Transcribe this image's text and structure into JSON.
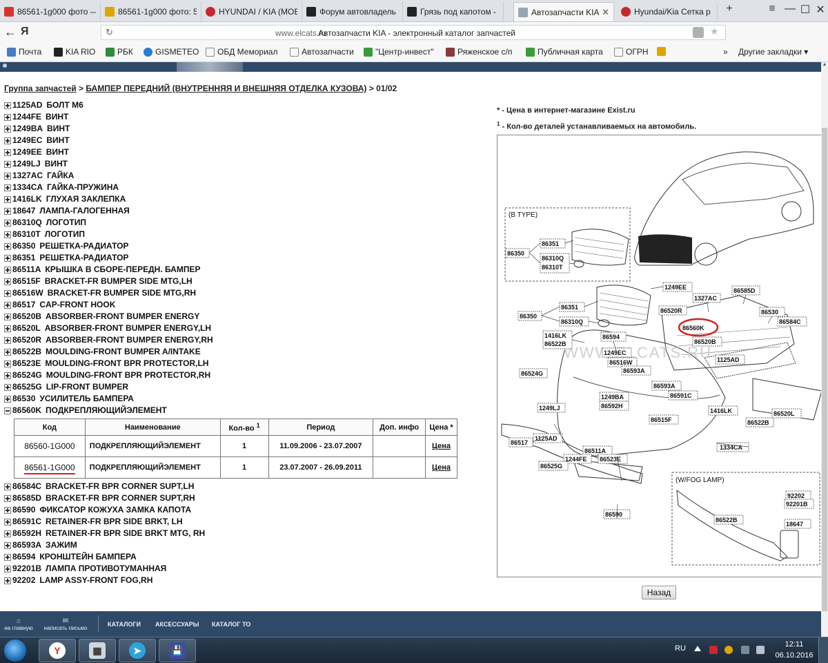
{
  "browser": {
    "tabs": [
      {
        "title": "86561-1g000 фото —",
        "color": "#d9342b"
      },
      {
        "title": "86561-1g000 фото: 5",
        "color": "#e0a400"
      },
      {
        "title": "HYUNDAI / KIA (MOB",
        "color": "#c8282d"
      },
      {
        "title": "Форум автовладель",
        "color": "#222222"
      },
      {
        "title": "Грязь под капотом -",
        "color": "#222222"
      },
      {
        "title": "Автозапчасти KIA",
        "color": "#9aa5b1"
      },
      {
        "title": "Hyundai/Kia Сетка р",
        "color": "#c8282d"
      }
    ],
    "new_tab": "+",
    "window_controls": {
      "menu": "≡",
      "minimize": "—",
      "maximize": "☐",
      "close": "✕"
    },
    "back": "←",
    "yandex_logo": "Я",
    "reload": "↻",
    "url_domain": "www.elcats.ru",
    "url_title": "Автозапчасти KIA - электронный каталог запчастей",
    "bookmarks": [
      {
        "label": "Почта",
        "color": "#4a7bc4"
      },
      {
        "label": "KIA RIO",
        "color": "#222222"
      },
      {
        "label": "РБК",
        "color": "#2d8a3e"
      },
      {
        "label": "GISMETEO",
        "color": "#2b7bd6"
      },
      {
        "label": "ОБД Мемориал",
        "color": "#888888"
      },
      {
        "label": "Автозапчасти",
        "color": "#888888"
      },
      {
        "label": "\"Центр-инвест\"",
        "color": "#3c9a3c"
      },
      {
        "label": "Ряженское с/п",
        "color": "#8a3a3a"
      },
      {
        "label": "Публичная карта",
        "color": "#3c9a3c"
      },
      {
        "label": "ОГРН",
        "color": "#888888"
      },
      {
        "label": "",
        "color": "#e0a400"
      }
    ],
    "more_bookmarks": "»",
    "other_bookmarks": "Другие закладки ▾"
  },
  "page": {
    "breadcrumb": {
      "root": "Группа запчастей",
      "sep": ">",
      "group": "БАМПЕР ПЕРЕДНИЙ (ВНУТРЕННЯЯ И ВНЕШНЯЯ ОТДЕЛКА КУЗОВА)",
      "page": "01/02"
    },
    "parts_before": [
      {
        "code": "1125AD",
        "name": "БОЛТ М6"
      },
      {
        "code": "1244FE",
        "name": "ВИНТ"
      },
      {
        "code": "1249BA",
        "name": "ВИНТ"
      },
      {
        "code": "1249EC",
        "name": "ВИНТ"
      },
      {
        "code": "1249EE",
        "name": "ВИНТ"
      },
      {
        "code": "1249LJ",
        "name": "ВИНТ"
      },
      {
        "code": "1327AC",
        "name": "ГАЙКА"
      },
      {
        "code": "1334CA",
        "name": "ГАЙКА-ПРУЖИНА"
      },
      {
        "code": "1416LK",
        "name": "ГЛУХАЯ ЗАКЛЕПКА"
      },
      {
        "code": "18647",
        "name": "ЛАМПА-ГАЛОГЕННАЯ"
      },
      {
        "code": "86310Q",
        "name": "ЛОГОТИП"
      },
      {
        "code": "86310T",
        "name": "ЛОГОТИП"
      },
      {
        "code": "86350",
        "name": "РЕШЕТКА-РАДИАТОР"
      },
      {
        "code": "86351",
        "name": "РЕШЕТКА-РАДИАТОР"
      },
      {
        "code": "86511A",
        "name": "КРЫШКА В СБОРЕ-ПЕРЕДН. БАМПЕР"
      },
      {
        "code": "86515F",
        "name": "BRACKET-FR BUMPER SIDE MTG,LH"
      },
      {
        "code": "86516W",
        "name": "BRACKET-FR BUMPER SIDE MTG,RH"
      },
      {
        "code": "86517",
        "name": "CAP-FRONT HOOK"
      },
      {
        "code": "86520B",
        "name": "ABSORBER-FRONT BUMPER ENERGY"
      },
      {
        "code": "86520L",
        "name": "ABSORBER-FRONT BUMPER ENERGY,LH"
      },
      {
        "code": "86520R",
        "name": "ABSORBER-FRONT BUMPER ENERGY,RH"
      },
      {
        "code": "86522B",
        "name": "MOULDING-FRONT BUMPER A/INTAKE"
      },
      {
        "code": "86523E",
        "name": "MOULDING-FRONT BPR PROTECTOR,LH"
      },
      {
        "code": "86524G",
        "name": "MOULDING-FRONT BPR PROTECTOR,RH"
      },
      {
        "code": "86525G",
        "name": "LIP-FRONT BUMPER"
      },
      {
        "code": "86530",
        "name": "УСИЛИТЕЛЬ БАМПЕРА"
      }
    ],
    "expanded_part": {
      "code": "86560K",
      "name": "ПОДКРЕПЛЯЮЩИЙЭЛЕМЕНТ"
    },
    "table": {
      "headers": [
        "Код",
        "Наименование",
        "Кол-во",
        "Период",
        "Доп. инфо",
        "Цена *"
      ],
      "qty_sup": "1",
      "rows": [
        {
          "code": "86560-1G000",
          "name": "ПОДКРЕПЛЯЮЩИЙЭЛЕМЕНТ",
          "qty": "1",
          "period": "11.09.2006 - 23.07.2007",
          "info": "",
          "price": "Цена"
        },
        {
          "code": "86561-1G000",
          "name": "ПОДКРЕПЛЯЮЩИЙЭЛЕМЕНТ",
          "qty": "1",
          "period": "23.07.2007 - 26.09.2011",
          "info": "",
          "price": "Цена"
        }
      ]
    },
    "parts_after": [
      {
        "code": "86584C",
        "name": "BRACKET-FR BPR CORNER SUPT,LH"
      },
      {
        "code": "86585D",
        "name": "BRACKET-FR BPR CORNER SUPT,RH"
      },
      {
        "code": "86590",
        "name": "ФИКСАТОР КОЖУХА ЗАМКА КАПОТА"
      },
      {
        "code": "86591C",
        "name": "RETAINER-FR BPR SIDE BRKT, LH"
      },
      {
        "code": "86592H",
        "name": "RETAINER-FR BPR SIDE BRKT MTG, RH"
      },
      {
        "code": "86593A",
        "name": "ЗАЖИМ"
      },
      {
        "code": "86594",
        "name": "КРОНШТЕЙН БАМПЕРА"
      },
      {
        "code": "92201B",
        "name": "ЛАМПА ПРОТИВОТУМАННАЯ"
      },
      {
        "code": "92202",
        "name": "LAMP ASSY-FRONT FOG,RH"
      }
    ],
    "notes": {
      "price_mark": "*",
      "price_note": " - Цена в интернет-магазине Exist.ru",
      "qty_mark": "1",
      "qty_note": " - Кол-во деталей устанавливаемых на автомобиль."
    },
    "diagram": {
      "b_type_label": "(B TYPE)",
      "fog_label": "(W/FOG LAMP)",
      "watermark": "WWW.ELCATS.RU",
      "callouts": {
        "c86350a": "86350",
        "c86351a": "86351",
        "c86310Qa": "86310Q",
        "c86310Ta": "86310T",
        "c1249EE": "1249EE",
        "c1327AC": "1327AC",
        "c86585D": "86585D",
        "c86351b": "86351",
        "c86520R": "86520R",
        "c86530": "86530",
        "c86350b": "86350",
        "c86310Qb": "86310Q",
        "c86560K": "86560K",
        "c86584C": "86584C",
        "c1416LKa": "1416LK",
        "c86522Ba": "86522B",
        "c86594": "86594",
        "c86520B": "86520B",
        "c1249EC": "1249EC",
        "c1125ADa": "1125AD",
        "c86516W": "86516W",
        "c86524G": "86524G",
        "c86593Aa": "86593A",
        "c86593Ab": "86593A",
        "c1249BA": "1249BA",
        "c86592H": "86592H",
        "c86591C": "86591C",
        "c1249LJ": "1249LJ",
        "c86515F": "86515F",
        "c1416LKb": "1416LK",
        "c86522Bb": "86522B",
        "c86520L": "86520L",
        "c86517": "86517",
        "c1125ADb": "1125AD",
        "c86511A": "86511A",
        "c1334CA": "1334CA",
        "c1244FE": "1244FE",
        "c86523E": "86523E",
        "c86525G": "86525G",
        "c86590": "86590",
        "c92202": "92202",
        "c92201B": "92201B",
        "c86522Bc": "86522B",
        "c18647": "18647"
      }
    },
    "back_button": "Назад",
    "footer": {
      "home": "на главную",
      "write": "написать письмо",
      "links": [
        "КАТАЛОГИ",
        "АКСЕССУАРЫ",
        "КАТАЛОГ ТО"
      ]
    }
  },
  "taskbar": {
    "apps": [
      {
        "glyph": "Y",
        "color": "#e02b20",
        "bg": "#ffffff"
      },
      {
        "glyph": "▦",
        "color": "#333333",
        "bg": "#cfd6de"
      },
      {
        "glyph": "➤",
        "color": "#ffffff",
        "bg": "#2ea3dc"
      },
      {
        "glyph": "💾",
        "color": "#ffffff",
        "bg": "#3a4fa0"
      }
    ],
    "lang": "RU",
    "time": "12:11",
    "date": "06.10.2016"
  }
}
